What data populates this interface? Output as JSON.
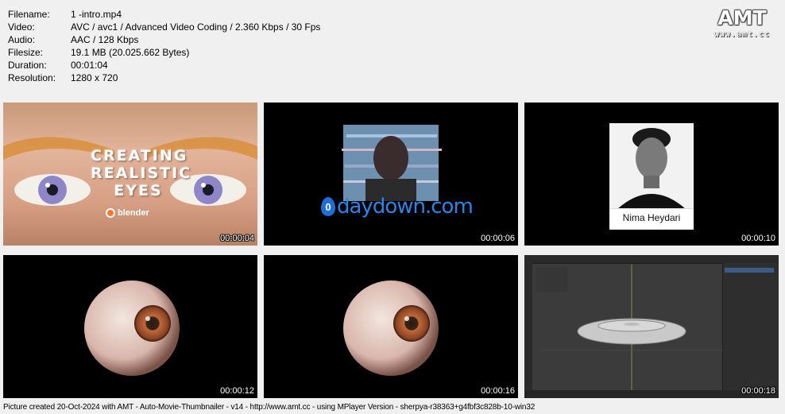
{
  "meta": {
    "rows": [
      {
        "label": "Filename:",
        "value": "1 -intro.mp4"
      },
      {
        "label": "Video:",
        "value": "AVC / avc1 / Advanced Video Coding / 2.360 Kbps / 30 Fps"
      },
      {
        "label": "Audio:",
        "value": "AAC / 128 Kbps"
      },
      {
        "label": "Filesize:",
        "value": "19.1 MB (20.025.662 Bytes)"
      },
      {
        "label": "Duration:",
        "value": "00:01:04"
      },
      {
        "label": "Resolution:",
        "value": "1280 x 720"
      }
    ]
  },
  "logo": {
    "title": "AMT",
    "url": "www.amt.cc"
  },
  "thumbs": [
    {
      "timestamp": "00:00:04",
      "title_lines": [
        "CREATING",
        "REALISTIC",
        "EYES"
      ],
      "brand": "blender"
    },
    {
      "timestamp": "00:00:06",
      "watermark_digit": "0",
      "watermark_text": "daydown.com"
    },
    {
      "timestamp": "00:00:10",
      "name": "Nima Heydari"
    },
    {
      "timestamp": "00:00:12"
    },
    {
      "timestamp": "00:00:16"
    },
    {
      "timestamp": "00:00:18"
    }
  ],
  "footer": "Picture created 20-Oct-2024 with AMT - Auto-Movie-Thumbnailer - v14 - http://www.amt.cc - using MPlayer Version - sherpya-r38363+g4fbf3c828b-10-win32",
  "colors": {
    "background": "#f0f0f0",
    "thumb_bg": "#000000",
    "accent_blue": "#2b84e8",
    "blender_orange": "#f5792a"
  }
}
